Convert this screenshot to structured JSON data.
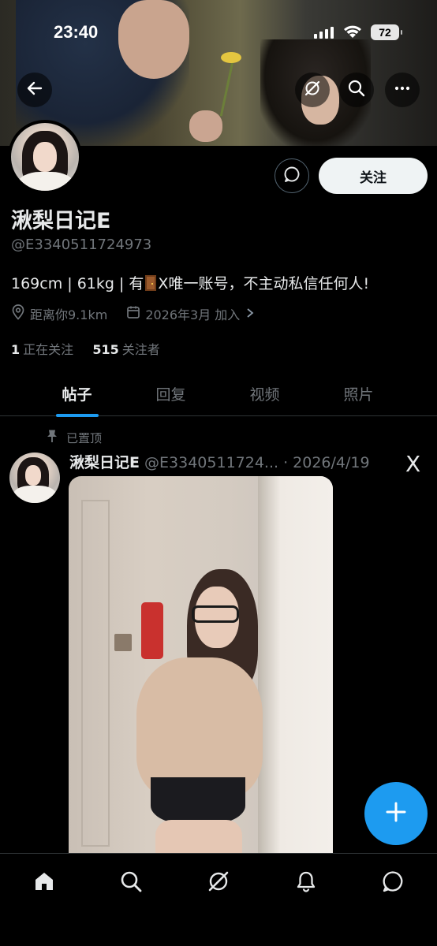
{
  "status_bar": {
    "time": "23:40",
    "battery": "72"
  },
  "profile": {
    "name": "湫梨日记E",
    "handle": "@E3340511724973",
    "bio_before_emoji": "169cm | 61kg | 有",
    "bio_emoji": "door",
    "bio_after_emoji": "X唯一账号，不主动私信任何人!",
    "location": "距离你9.1km",
    "joined": "2026年3月 加入",
    "following_count": "1",
    "following_label": "正在关注",
    "followers_count": "515",
    "followers_label": "关注者",
    "follow_button_label": "关注"
  },
  "tabs": [
    {
      "label": "帖子",
      "active": true
    },
    {
      "label": "回复",
      "active": false
    },
    {
      "label": "视频",
      "active": false
    },
    {
      "label": "照片",
      "active": false
    }
  ],
  "post": {
    "pinned_label": "已置顶",
    "author_name": "湫梨日记E",
    "author_handle": "@E3340511724...",
    "date": "2026/4/19",
    "source_logo": "X"
  },
  "icons": {
    "back": "arrow-left-icon",
    "grok": "grok-icon",
    "search": "search-icon",
    "more": "more-icon",
    "message": "message-icon",
    "location": "location-pin-icon",
    "calendar": "calendar-icon",
    "pin": "pin-icon",
    "compose": "plus-icon",
    "nav": [
      "home-icon",
      "search-icon",
      "grok-icon",
      "bell-icon",
      "chat-icon"
    ]
  },
  "colors": {
    "accent": "#1d9bf0",
    "background": "#000000",
    "secondary_text": "#71767b",
    "primary_text": "#e7e9ea"
  }
}
